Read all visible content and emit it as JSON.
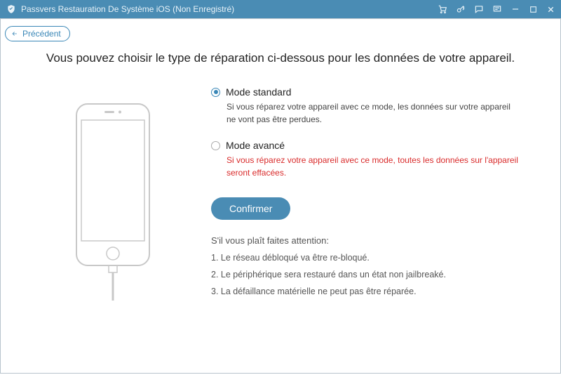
{
  "titlebar": {
    "title": "Passvers Restauration De Système iOS (Non Enregistré)"
  },
  "back": {
    "label": "Précédent"
  },
  "heading": "Vous pouvez choisir le type de réparation ci-dessous pour les données de votre appareil.",
  "options": {
    "standard": {
      "label": "Mode standard",
      "desc": "Si vous réparez votre appareil avec ce mode, les données sur votre appareil ne vont pas être perdues."
    },
    "advanced": {
      "label": "Mode avancé",
      "desc": "Si vous réparez votre appareil avec ce mode, toutes les données sur l'appareil seront effacées."
    }
  },
  "confirm_label": "Confirmer",
  "attention": {
    "title": "S'il vous plaît faites attention:",
    "items": [
      "1. Le réseau débloqué va être re-bloqué.",
      "2. Le périphérique sera restauré dans un état non jailbreaké.",
      "3. La défaillance matérielle ne peut pas être réparée."
    ]
  }
}
